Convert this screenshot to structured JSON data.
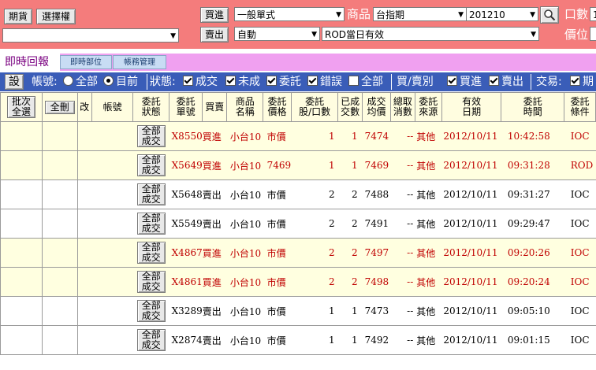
{
  "top": {
    "futures_button": "期貨",
    "options_button": "選擇權",
    "buy_button": "買進",
    "sell_button": "賣出",
    "order_type": "一般單式",
    "product_label": "商品",
    "product": "台指期",
    "month": "201210",
    "auto": "自動",
    "tif": "ROD當日有效",
    "lots_label": "口數",
    "lots_value": "1",
    "price_label": "價位",
    "account": ""
  },
  "tabs": {
    "realtime_report": "即時回報",
    "realtime_position": "即時部位",
    "account_mgmt": "帳務管理"
  },
  "filter": {
    "settings": "設",
    "account_label": "帳號:",
    "all": "全部",
    "current": "目前",
    "status_label": "狀態:",
    "filled": "成交",
    "unfilled": "未成",
    "entrusted": "委託",
    "error": "錯誤",
    "all2": "全部",
    "buysell_label": "買/賣別",
    "buy": "買進",
    "sell": "賣出",
    "trade_label": "交易:",
    "futures_cut": "期"
  },
  "table": {
    "headers": {
      "batch_select": "批次\n全選",
      "delete_all": "全刪",
      "modify": "改",
      "account": "帳號",
      "status": "委託\n狀態",
      "order_no": "委託\n單號",
      "buysell": "買賣",
      "product_name": "商品\n名稱",
      "price": "委託\n價格",
      "qty": "委託\n股/口數",
      "filled_qty": "已成\n交數",
      "avg_price": "成交\n均價",
      "cancel_qty": "總取\n消數",
      "source": "委託\n來源",
      "valid_date": "有效\n日期",
      "order_time": "委託\n時間",
      "condition": "委託\n條件"
    },
    "status_button": "全部\n成交",
    "rows": [
      {
        "order_no": "X8550",
        "side": "買進",
        "product": "小台10",
        "price": "市價",
        "qty": "1",
        "filled": "1",
        "avg": "7474",
        "cancel": "--",
        "source": "其他",
        "date": "2012/10/11",
        "time": "10:42:58",
        "cond": "IOC",
        "color": "red",
        "bg": "r"
      },
      {
        "order_no": "X5649",
        "side": "買進",
        "product": "小台10",
        "price": "7469",
        "qty": "1",
        "filled": "1",
        "avg": "7469",
        "cancel": "--",
        "source": "其他",
        "date": "2012/10/11",
        "time": "09:31:28",
        "cond": "ROD",
        "color": "red",
        "bg": "r"
      },
      {
        "order_no": "X5648",
        "side": "賣出",
        "product": "小台10",
        "price": "市價",
        "qty": "2",
        "filled": "2",
        "avg": "7488",
        "cancel": "--",
        "source": "其他",
        "date": "2012/10/11",
        "time": "09:31:27",
        "cond": "IOC",
        "color": "blk",
        "bg": "w"
      },
      {
        "order_no": "X5549",
        "side": "賣出",
        "product": "小台10",
        "price": "市價",
        "qty": "2",
        "filled": "2",
        "avg": "7491",
        "cancel": "--",
        "source": "其他",
        "date": "2012/10/11",
        "time": "09:29:47",
        "cond": "IOC",
        "color": "blk",
        "bg": "w"
      },
      {
        "order_no": "X4867",
        "side": "買進",
        "product": "小台10",
        "price": "市價",
        "qty": "2",
        "filled": "2",
        "avg": "7497",
        "cancel": "--",
        "source": "其他",
        "date": "2012/10/11",
        "time": "09:20:26",
        "cond": "IOC",
        "color": "red",
        "bg": "r"
      },
      {
        "order_no": "X4861",
        "side": "買進",
        "product": "小台10",
        "price": "市價",
        "qty": "2",
        "filled": "2",
        "avg": "7498",
        "cancel": "--",
        "source": "其他",
        "date": "2012/10/11",
        "time": "09:20:24",
        "cond": "IOC",
        "color": "red",
        "bg": "r"
      },
      {
        "order_no": "X3289",
        "side": "賣出",
        "product": "小台10",
        "price": "市價",
        "qty": "1",
        "filled": "1",
        "avg": "7473",
        "cancel": "--",
        "source": "其他",
        "date": "2012/10/11",
        "time": "09:05:10",
        "cond": "IOC",
        "color": "blk",
        "bg": "w"
      },
      {
        "order_no": "X2874",
        "side": "賣出",
        "product": "小台10",
        "price": "市價",
        "qty": "1",
        "filled": "1",
        "avg": "7492",
        "cancel": "--",
        "source": "其他",
        "date": "2012/10/11",
        "time": "09:01:15",
        "cond": "IOC",
        "color": "blk",
        "bg": "w"
      }
    ]
  }
}
